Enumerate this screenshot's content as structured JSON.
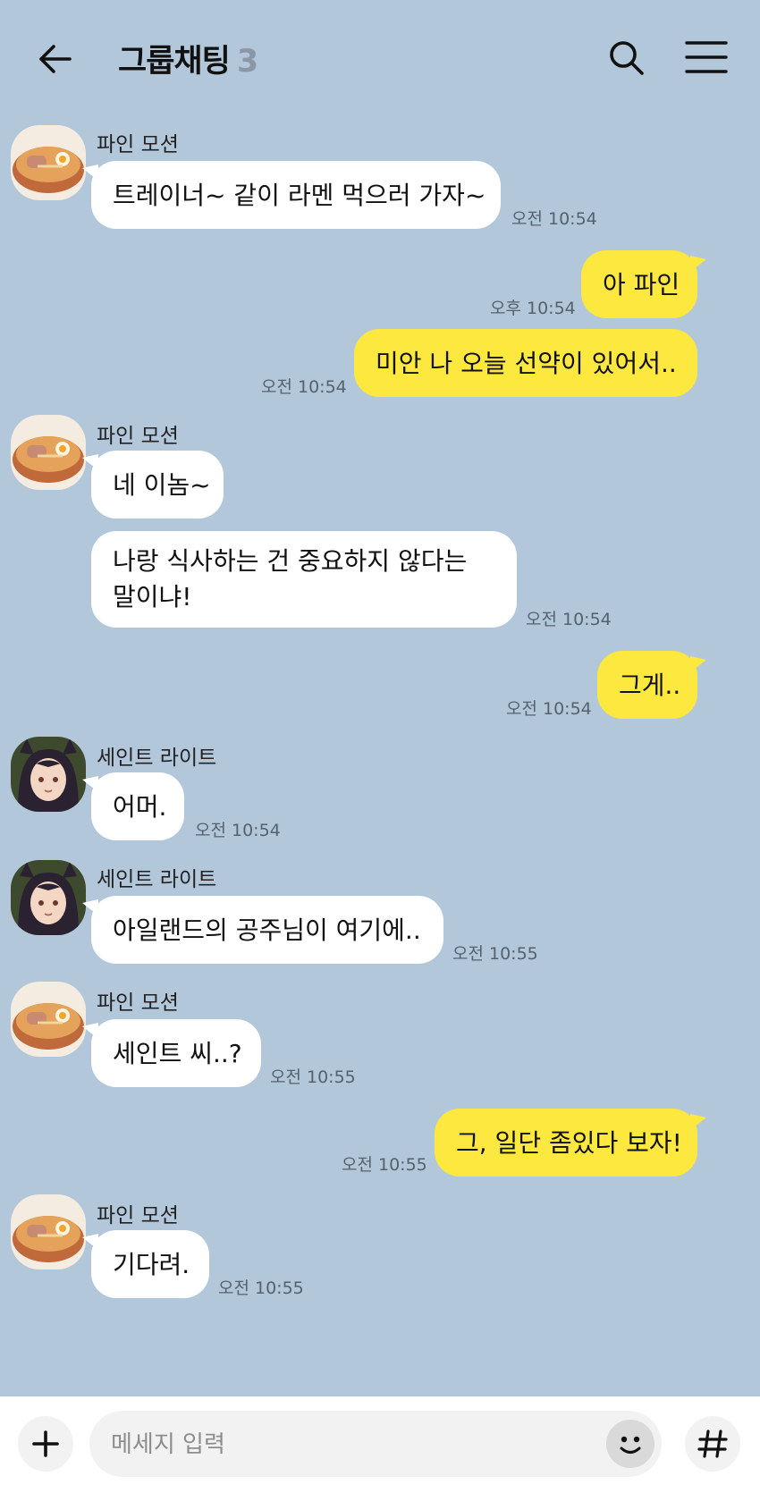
{
  "header": {
    "title": "그룹채팅",
    "member_count": "3"
  },
  "messages": [
    {
      "sender": "파인 모션",
      "text": "트레이너~ 같이 라멘 먹으러 가자~",
      "time": "오전 10:54"
    },
    {
      "text": "아 파인",
      "time": "오후 10:54"
    },
    {
      "text": "미안 나 오늘 선약이 있어서..",
      "time": "오전 10:54"
    },
    {
      "sender": "파인 모션",
      "text": "네 이놈~"
    },
    {
      "text": "나랑 식사하는 건 중요하지 않다는 말이냐!",
      "time": "오전 10:54"
    },
    {
      "text": "그게..",
      "time": "오전 10:54"
    },
    {
      "sender": "세인트 라이트",
      "text": "어머.",
      "time": "오전 10:54"
    },
    {
      "sender": "세인트 라이트",
      "text": "아일랜드의 공주님이 여기에..",
      "time": "오전 10:55"
    },
    {
      "sender": "파인 모션",
      "text": "세인트 씨..?",
      "time": "오전 10:55"
    },
    {
      "text": "그, 일단 좀있다 보자!",
      "time": "오전 10:55"
    },
    {
      "sender": "파인 모션",
      "text": "기다려.",
      "time": "오전 10:55"
    }
  ],
  "footer": {
    "placeholder": "메세지 입력"
  },
  "icons": {
    "back": "arrow-left-icon",
    "search": "search-icon",
    "menu": "hamburger-menu-icon",
    "plus": "plus-icon",
    "emoji": "smiley-icon",
    "hash": "hashtag-icon"
  },
  "colors": {
    "background": "#b2c7da",
    "bubble_in": "#ffffff",
    "bubble_out": "#fde83f",
    "time_text": "#55626e",
    "count_text": "#8a98a6"
  }
}
